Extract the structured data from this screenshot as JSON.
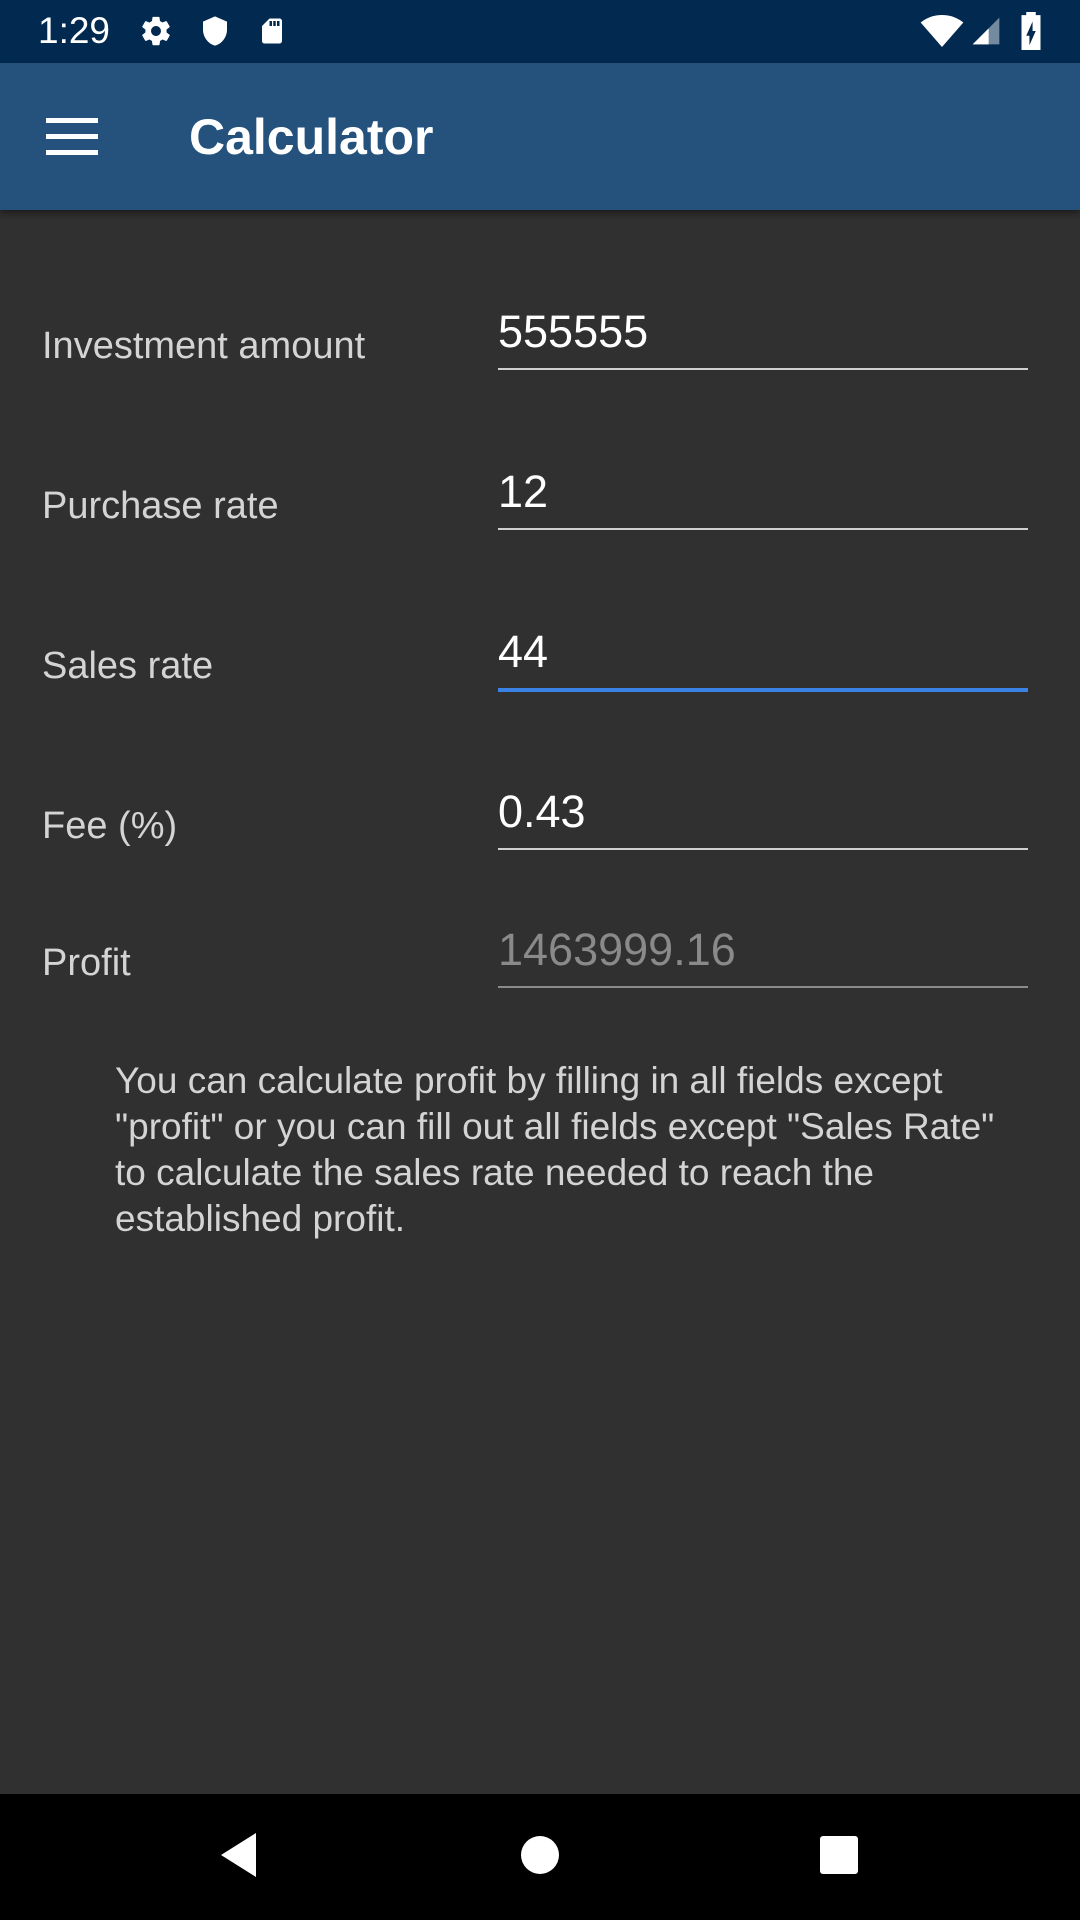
{
  "status_bar": {
    "time": "1:29",
    "left_icons": [
      "gear-icon",
      "shield-icon",
      "sd-card-icon"
    ],
    "right_icons": [
      "wifi-icon",
      "signal-icon",
      "battery-charging-icon"
    ]
  },
  "app_bar": {
    "title": "Calculator",
    "menu_icon": "hamburger-menu-icon"
  },
  "form": {
    "investment": {
      "label": "Investment amount",
      "value": "555555"
    },
    "purchase": {
      "label": "Purchase rate",
      "value": "12"
    },
    "sales": {
      "label": "Sales rate",
      "value": "44"
    },
    "fee": {
      "label": "Fee (%)",
      "value": "0.43"
    },
    "profit": {
      "label": "Profit",
      "value": "1463999.16"
    }
  },
  "help_text": "You can calculate profit by filling in all fields except \"profit\" or you can fill out all fields except \"Sales Rate\" to calculate the sales rate needed to reach the established profit.",
  "colors": {
    "status_bar": "#022a50",
    "app_bar": "#24527c",
    "background": "#303030",
    "focus_accent": "#3b82e6"
  },
  "nav_bar": {
    "buttons": [
      "back-icon",
      "home-icon",
      "recents-icon"
    ]
  }
}
